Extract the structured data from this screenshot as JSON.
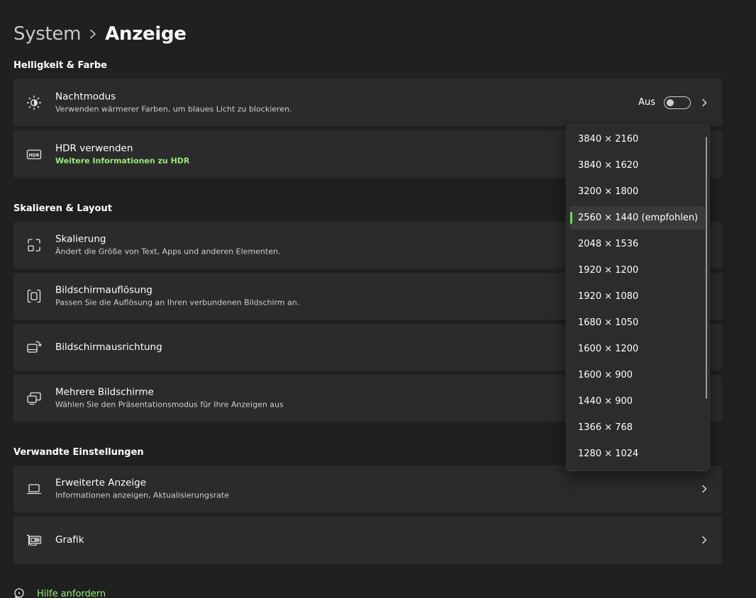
{
  "breadcrumb": {
    "parent": "System",
    "current": "Anzeige"
  },
  "sections": {
    "brightness_title": "Helligkeit & Farbe",
    "scale_title": "Skalieren & Layout",
    "related_title": "Verwandte Einstellungen"
  },
  "cards": {
    "night_mode": {
      "title": "Nachtmodus",
      "subtitle": "Verwenden wärmerer Farben, um blaues Licht zu blockieren.",
      "toggle_label": "Aus",
      "toggle_on": false,
      "icon": "brightness-icon"
    },
    "hdr": {
      "title": "HDR verwenden",
      "link": "Weitere Informationen zu HDR",
      "icon": "hdr-icon"
    },
    "scaling": {
      "title": "Skalierung",
      "subtitle": "Ändert die Größe von Text, Apps und anderen Elementen.",
      "icon": "scale-icon"
    },
    "resolution": {
      "title": "Bildschirmauflösung",
      "subtitle": "Passen Sie die Auflösung an Ihren verbundenen Bildschirm an.",
      "icon": "resolution-icon"
    },
    "orientation": {
      "title": "Bildschirmausrichtung",
      "icon": "rotate-screen-icon"
    },
    "multiple_displays": {
      "title": "Mehrere Bildschirme",
      "subtitle": "Wählen Sie den Präsentationsmodus für Ihre Anzeigen aus",
      "icon": "multiple-displays-icon"
    },
    "advanced_display": {
      "title": "Erweiterte Anzeige",
      "subtitle": "Informationen anzeigen, Aktualisierungsrate",
      "icon": "laptop-icon"
    },
    "graphics": {
      "title": "Grafik",
      "icon": "graphics-card-icon"
    }
  },
  "resolution_dropdown": {
    "selected_index": 3,
    "accent_color": "#5ee04a",
    "options": [
      "3840 × 2160",
      "3840 × 1620",
      "3200 × 1800",
      "2560 × 1440 (empfohlen)",
      "2048 × 1536",
      "1920 × 1200",
      "1920 × 1080",
      "1680 × 1050",
      "1600 × 1200",
      "1600 × 900",
      "1440 × 900",
      "1366 × 768",
      "1280 × 1024"
    ]
  },
  "help": {
    "label": "Hilfe anfordern",
    "icon": "help-chat-icon"
  },
  "colors": {
    "background": "#202020",
    "card": "#2b2b2b",
    "link": "#99ec78"
  }
}
